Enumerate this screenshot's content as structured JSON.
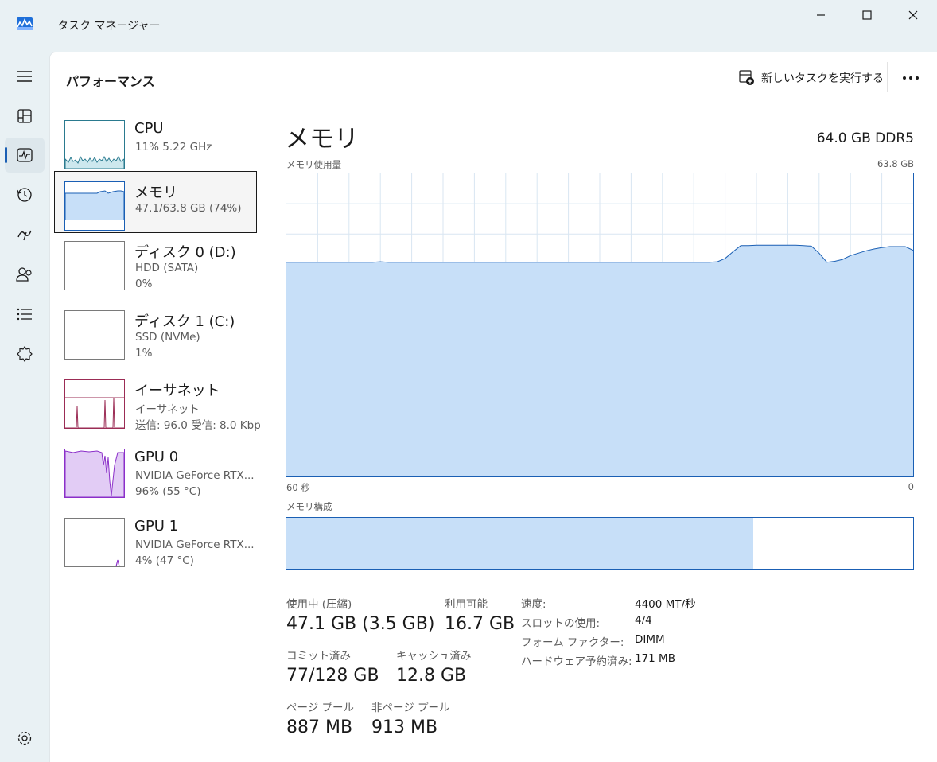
{
  "window": {
    "title": "タスク マネージャー"
  },
  "nav": [
    "menu-icon",
    "processes-icon",
    "performance-icon",
    "app-history-icon",
    "startup-apps-icon",
    "users-icon",
    "details-icon",
    "services-icon",
    "settings-icon"
  ],
  "header": {
    "page_title": "パフォーマンス",
    "run_task_label": "新しいタスクを実行する",
    "more": "…"
  },
  "sidebar": {
    "items": [
      {
        "name": "CPU",
        "line1": "11%  5.22 GHz",
        "line2": ""
      },
      {
        "name": "メモリ",
        "line1": "47.1/63.8 GB (74%)",
        "line2": ""
      },
      {
        "name": "ディスク 0 (D:)",
        "line1": "HDD (SATA)",
        "line2": "0%"
      },
      {
        "name": "ディスク 1 (C:)",
        "line1": "SSD (NVMe)",
        "line2": "1%"
      },
      {
        "name": "イーサネット",
        "line1": "イーサネット",
        "line2": "送信: 96.0  受信: 8.0 Kbp"
      },
      {
        "name": "GPU 0",
        "line1": "NVIDIA GeForce RTX...",
        "line2": "96% (55 °C)"
      },
      {
        "name": "GPU 1",
        "line1": "NVIDIA GeForce RTX...",
        "line2": "4% (47 °C)"
      }
    ]
  },
  "main": {
    "title": "メモリ",
    "spec": "64.0 GB DDR5",
    "usage_label": "メモリ使用量",
    "usage_max": "63.8 GB",
    "time_left": "60 秒",
    "time_right": "0",
    "composition_label": "メモリ構成",
    "composition": {
      "in_use_fraction": 0.742,
      "modified_fraction": 0.003,
      "standby_fraction": 0.198,
      "free_fraction": 0.057
    },
    "stats": {
      "in_use_label": "使用中 (圧縮)",
      "in_use_value": "47.1 GB (3.5 GB)",
      "available_label": "利用可能",
      "available_value": "16.7 GB",
      "committed_label": "コミット済み",
      "committed_value": "77/128 GB",
      "cached_label": "キャッシュ済み",
      "cached_value": "12.8 GB",
      "paged_label": "ページ プール",
      "paged_value": "887 MB",
      "nonpaged_label": "非ページ プール",
      "nonpaged_value": "913 MB"
    },
    "details": [
      {
        "key": "速度:",
        "value": "4400 MT/秒"
      },
      {
        "key": "スロットの使用:",
        "value": "4/4"
      },
      {
        "key": "フォーム ファクター:",
        "value": "DIMM"
      },
      {
        "key": "ハードウェア予約済み:",
        "value": "171 MB"
      }
    ]
  },
  "chart_data": {
    "type": "area",
    "title": "メモリ使用量",
    "ylim": [
      0,
      63.8
    ],
    "xlabel": "",
    "ylabel": "",
    "series": [
      {
        "values": [
          45.1,
          45.1,
          45.1,
          45.1,
          45.1,
          45.1,
          45.1,
          45.1,
          45.1,
          45.1,
          45.1,
          45.1,
          45.2,
          45.1,
          45.1,
          45.1,
          45.1,
          45.1,
          45.1,
          45.1,
          45.1,
          45.1,
          45.1,
          45.1,
          45.1,
          45.1,
          45.1,
          45.1,
          45.1,
          45.1,
          45.1,
          45.1,
          45.1,
          45.1,
          45.1,
          45.1,
          45.1,
          45.1,
          45.1,
          45.1,
          45.1,
          45.1,
          45.1,
          45.1,
          45.1,
          45.1,
          45.1,
          45.1,
          45.1,
          45.1,
          45.1,
          45.1,
          45.1,
          45.1,
          45.1,
          45.2,
          45.9,
          47.3,
          48.6,
          48.6,
          48.7,
          48.7,
          48.7,
          48.7,
          48.7,
          48.7,
          48.6,
          48.5,
          47.0,
          45.1,
          45.3,
          45.7,
          46.5,
          47.0,
          47.5,
          47.9,
          48.2,
          48.4,
          48.4,
          48.4,
          47.6
        ]
      }
    ]
  }
}
